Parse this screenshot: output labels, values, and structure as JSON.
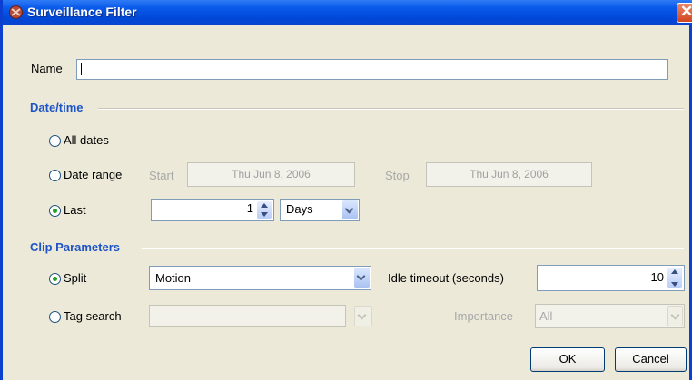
{
  "window": {
    "title": "Surveillance Filter",
    "close_glyph": "✕"
  },
  "name_field": {
    "label": "Name",
    "value": ""
  },
  "datetime": {
    "section_title": "Date/time",
    "all_dates_label": "All dates",
    "date_range_label": "Date range",
    "start_label": "Start",
    "start_value": "Thu Jun 8, 2006",
    "stop_label": "Stop",
    "stop_value": "Thu Jun 8, 2006",
    "last_label": "Last",
    "last_value": "1",
    "unit_value": "Days",
    "selected": "Last"
  },
  "clip": {
    "section_title": "Clip Parameters",
    "split_label": "Split",
    "split_value": "Motion",
    "idle_label": "Idle timeout (seconds)",
    "idle_value": "10",
    "tag_label": "Tag search",
    "tag_value": "",
    "importance_label": "Importance",
    "importance_value": "All",
    "selected": "Split"
  },
  "buttons": {
    "ok": "OK",
    "cancel": "Cancel"
  }
}
